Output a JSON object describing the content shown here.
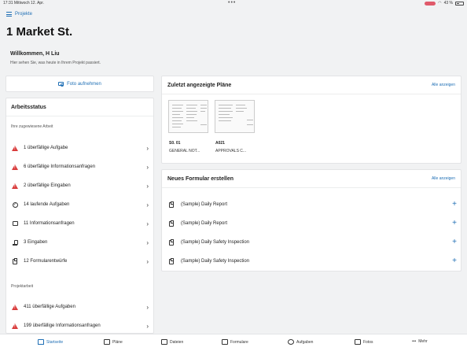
{
  "status_bar": {
    "time": "17:31",
    "date": "Mittwoch 12. Apr.",
    "battery": "43 %"
  },
  "header": {
    "projects_link": "Projekte",
    "title": "1 Market St.",
    "welcome": "Willkommen, H Liu",
    "welcome_sub": "Hier sehen Sie, was heute in Ihrem Projekt passiert."
  },
  "photo_button": {
    "label": "Foto aufnehmen"
  },
  "work_status": {
    "title": "Arbeitsstatus",
    "assigned_label": "Ihre zugewiesene Arbeit",
    "assigned_items": [
      {
        "icon": "warning-icon",
        "label": "1 überfällige Aufgabe"
      },
      {
        "icon": "warning-icon",
        "label": "6 überfällige Informationsanfragen"
      },
      {
        "icon": "warning-icon",
        "label": "2 überfällige Eingaben"
      },
      {
        "icon": "check-circle-icon",
        "label": "14 laufende Aufgaben"
      },
      {
        "icon": "chat-icon",
        "label": "11 Informationsanfragen"
      },
      {
        "icon": "stamp-icon",
        "label": "3 Eingaben"
      },
      {
        "icon": "clipboard-icon",
        "label": "12 Formularentwürfe"
      }
    ],
    "project_label": "Projektarbeit",
    "project_items": [
      {
        "icon": "warning-icon",
        "label": "411 überfällige Aufgaben"
      },
      {
        "icon": "warning-icon",
        "label": "199 überfällige Informationsanfragen"
      }
    ]
  },
  "recent_plans": {
    "title": "Zuletzt angezeigte Pläne",
    "show_all": "Alle anzeigen",
    "plans": [
      {
        "code": "S0. 01",
        "name": "GENERAL NOT..."
      },
      {
        "code": "A021",
        "name": "APPROVALS C..."
      }
    ]
  },
  "new_form": {
    "title": "Neues Formular erstellen",
    "show_all": "Alle anzeigen",
    "forms": [
      {
        "label": "(Sample) Daily Report"
      },
      {
        "label": "(Sample) Daily Report"
      },
      {
        "label": "(Sample) Daily Safety Inspection"
      },
      {
        "label": "(Sample) Daily Safety Inspection"
      }
    ]
  },
  "tabbar": {
    "tabs": [
      {
        "label": "Startseite",
        "icon": "home-icon",
        "active": true
      },
      {
        "label": "Pläne",
        "icon": "plans-icon",
        "active": false
      },
      {
        "label": "Dateien",
        "icon": "files-icon",
        "active": false
      },
      {
        "label": "Formulare",
        "icon": "forms-icon",
        "active": false
      },
      {
        "label": "Aufgaben",
        "icon": "tasks-icon",
        "active": false
      },
      {
        "label": "Fotos",
        "icon": "photos-icon",
        "active": false
      },
      {
        "label": "Mehr",
        "icon": "more-icon",
        "active": false
      }
    ]
  },
  "colors": {
    "accent": "#1f6fb5",
    "warning": "#d93a3a",
    "background": "#f1f2f3"
  }
}
